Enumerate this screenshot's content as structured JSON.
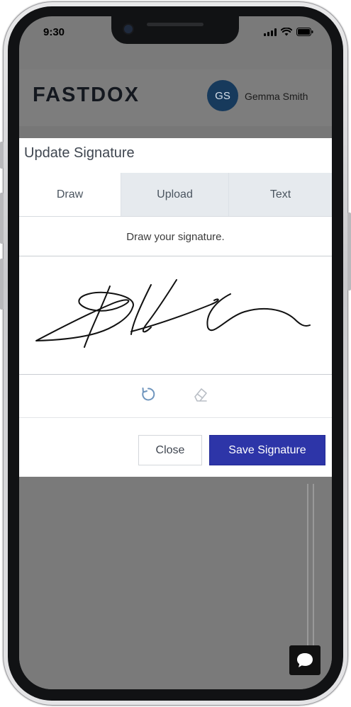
{
  "status_bar": {
    "time": "9:30"
  },
  "header": {
    "logo_text": "FASTDOX",
    "avatar_initials": "GS",
    "user_name": "Gemma Smith"
  },
  "modal": {
    "title": "Update Signature",
    "tabs": [
      {
        "label": "Draw",
        "active": true
      },
      {
        "label": "Upload",
        "active": false
      },
      {
        "label": "Text",
        "active": false
      }
    ],
    "instruction": "Draw your signature.",
    "tools": {
      "undo_icon": "undo-icon",
      "eraser_icon": "eraser-icon"
    },
    "close_label": "Close",
    "save_label": "Save Signature"
  },
  "colors": {
    "primary_button": "#2d35a8",
    "avatar_bg": "#173a5c",
    "tab_inactive_bg": "#e6eaee",
    "overlay": "#7a7a7a"
  },
  "chat_icon": "chat-bubble-icon"
}
